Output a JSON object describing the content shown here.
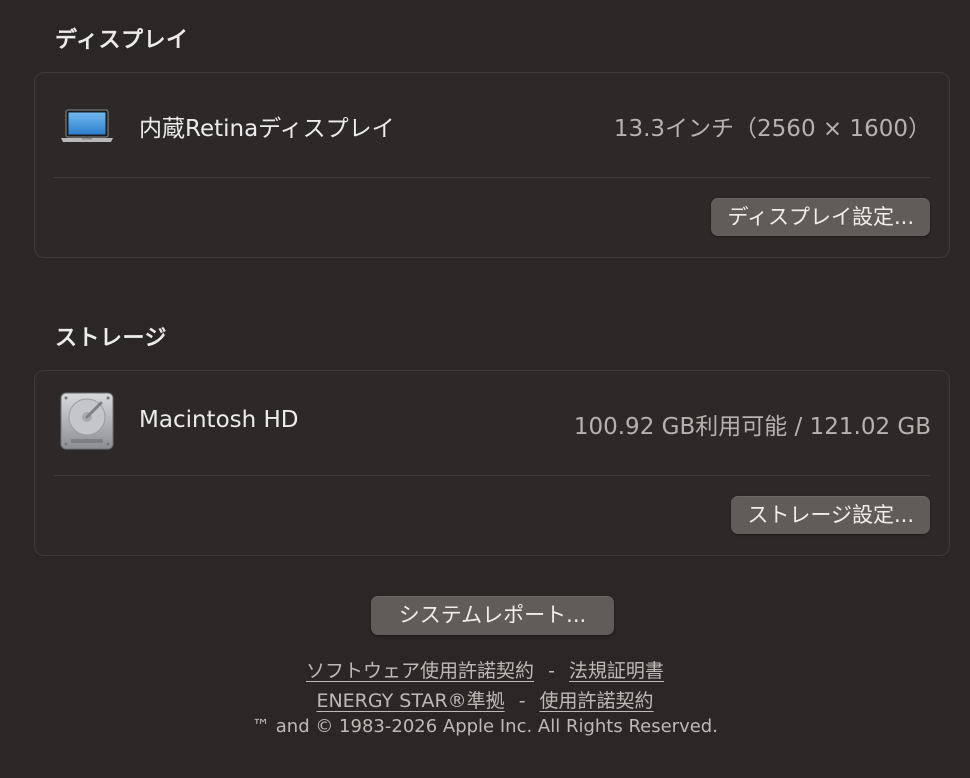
{
  "display_section": {
    "title": "ディスプレイ",
    "item_name": "内蔵Retinaディスプレイ",
    "item_value": "13.3インチ（2560 × 1600）",
    "icon": "laptop-icon",
    "settings_button": "ディスプレイ設定..."
  },
  "storage_section": {
    "title": "ストレージ",
    "item_name": "Macintosh HD",
    "item_value": "100.92 GB利用可能 / 121.02 GB",
    "icon": "hard-disk-icon",
    "settings_button": "ストレージ設定..."
  },
  "system_report_button": "システムレポート...",
  "footer": {
    "link_software_license": "ソフトウェア使用許諾契約",
    "sep1": "-",
    "link_regulatory": "法規証明書",
    "link_energy_star": "ENERGY STAR®準拠",
    "sep2": "-",
    "link_license": "使用許諾契約",
    "copyright": "™ and © 1983-2026 Apple Inc. All Rights Reserved."
  },
  "colors": {
    "background": "#2a2726",
    "card_background": "#2c2928",
    "button": "#5f5c5a",
    "secondary_text": "#b5b2af"
  }
}
